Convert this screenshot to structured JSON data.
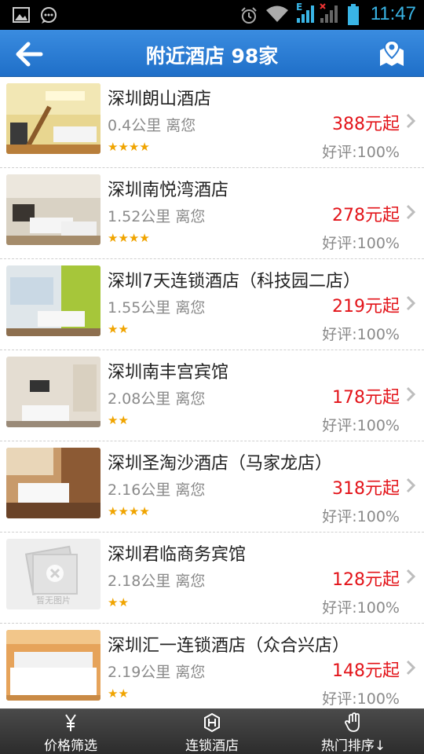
{
  "status_bar": {
    "time": "11:47",
    "network_label": "E",
    "icons": [
      "image-icon",
      "chat-icon",
      "alarm-icon",
      "wifi-icon",
      "signal-icon",
      "no-signal-icon",
      "battery-icon"
    ]
  },
  "header": {
    "title": "附近酒店  98家",
    "back_icon": "arrow-left-icon",
    "map_icon": "map-pin-icon"
  },
  "hotels": [
    {
      "name": "深圳朗山酒店",
      "distance": "0.4公里 离您",
      "price": "388元起",
      "stars": "★★★★",
      "rating": "好评:100%",
      "thumb": "loft"
    },
    {
      "name": "深圳南悦湾酒店",
      "distance": "1.52公里 离您",
      "price": "278元起",
      "stars": "★★★★",
      "rating": "好评:100%",
      "thumb": "twin"
    },
    {
      "name": "深圳7天连锁酒店（科技园二店）",
      "distance": "1.55公里 离您",
      "price": "219元起",
      "stars": "★★",
      "rating": "好评:100%",
      "thumb": "green"
    },
    {
      "name": "深圳南丰宫宾馆",
      "distance": "2.08公里 离您",
      "price": "178元起",
      "stars": "★★",
      "rating": "好评:100%",
      "thumb": "room"
    },
    {
      "name": "深圳圣淘沙酒店（马家龙店）",
      "distance": "2.16公里 离您",
      "price": "318元起",
      "stars": "★★★★",
      "rating": "好评:100%",
      "thumb": "warm"
    },
    {
      "name": "深圳君临商务宾馆",
      "distance": "2.18公里 离您",
      "price": "128元起",
      "stars": "★★",
      "rating": "好评:100%",
      "thumb": "none",
      "placeholder_text": "暂无图片"
    },
    {
      "name": "深圳汇一连锁酒店（众合兴店）",
      "distance": "2.19公里 离您",
      "price": "148元起",
      "stars": "★★",
      "rating": "好评:100%",
      "thumb": "white"
    }
  ],
  "bottom_tabs": [
    {
      "label": "价格筛选",
      "icon": "yen-icon"
    },
    {
      "label": "连锁酒店",
      "icon": "hotel-badge-icon"
    },
    {
      "label": "热门排序↓",
      "icon": "hand-icon"
    }
  ],
  "colors": {
    "header_blue": "#1f6fc8",
    "price_red": "#e3141a",
    "star_gold": "#f0a400",
    "bottom_bar": "#2c2c2c"
  }
}
